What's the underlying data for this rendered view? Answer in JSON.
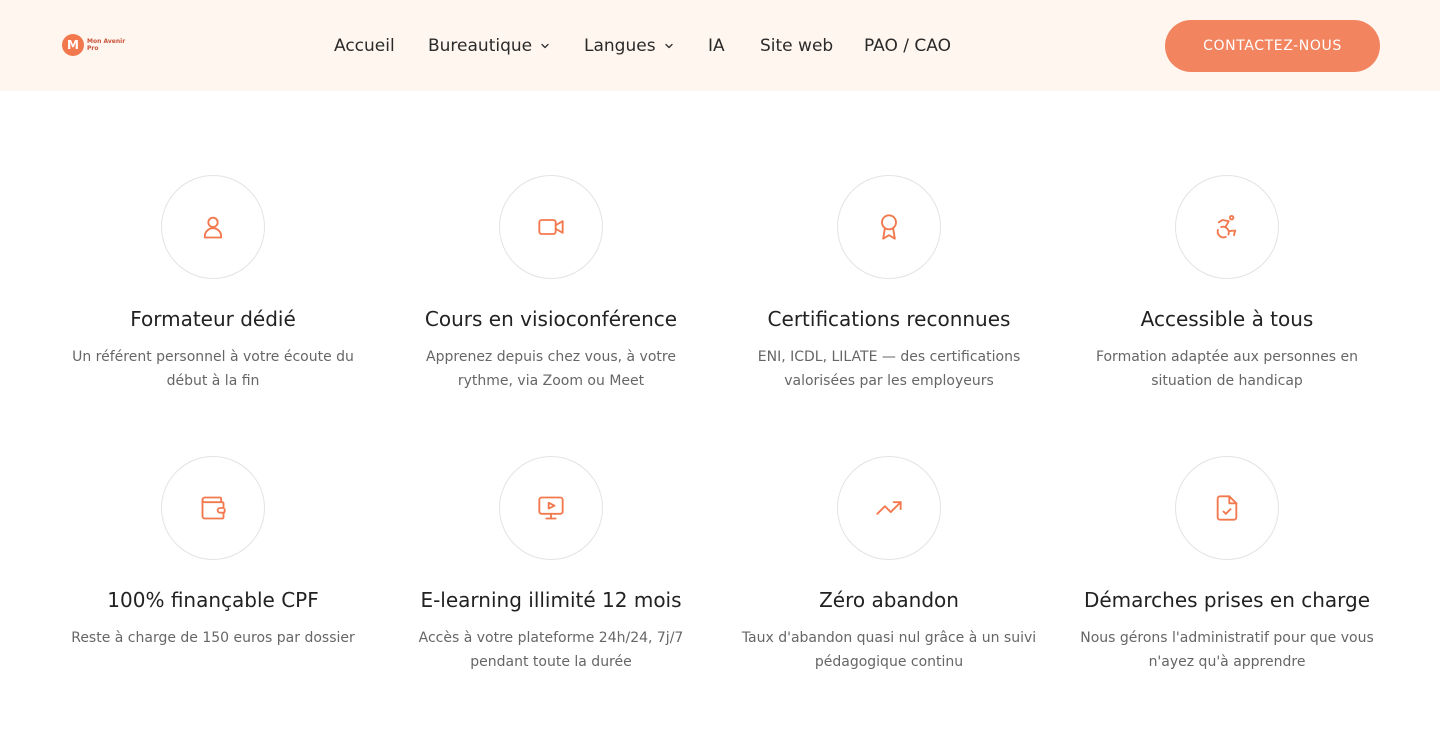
{
  "header": {
    "logo": {
      "mark": "M",
      "line1": "Mon Avenir",
      "line2": "Pro"
    },
    "nav": [
      {
        "label": "Accueil"
      },
      {
        "label": "Bureautique"
      },
      {
        "label": "Langues"
      },
      {
        "label": "IA"
      },
      {
        "label": "Site web"
      },
      {
        "label": "PAO / CAO"
      }
    ],
    "cta_label": "CONTACTEZ-NOUS"
  },
  "colors": {
    "accent": "#f2855f",
    "header_bg": "#fff6ef",
    "icon": "#f2794e"
  },
  "features": [
    {
      "icon": "user-icon",
      "title": "Formateur dédié",
      "desc": "Un référent personnel à votre écoute du début à la fin"
    },
    {
      "icon": "video-camera-icon",
      "title": "Cours en visioconférence",
      "desc": "Apprenez depuis chez vous, à votre rythme, via Zoom ou Meet"
    },
    {
      "icon": "award-icon",
      "title": "Certifications reconnues",
      "desc": "ENI, ICDL, LILATE — des certifications valorisées par les employeurs"
    },
    {
      "icon": "accessibility-icon",
      "title": "Accessible à tous",
      "desc": "Formation adaptée aux personnes en situation de handicap"
    },
    {
      "icon": "wallet-icon",
      "title": "100% finançable CPF",
      "desc": "Reste à charge de 150 euros par dossier"
    },
    {
      "icon": "monitor-play-icon",
      "title": "E-learning illimité 12 mois",
      "desc": "Accès à votre plateforme 24h/24, 7j/7 pendant toute la durée"
    },
    {
      "icon": "trending-up-icon",
      "title": "Zéro abandon",
      "desc": "Taux d'abandon quasi nul grâce à un suivi pédagogique continu"
    },
    {
      "icon": "file-check-icon",
      "title": "Démarches prises en charge",
      "desc": "Nous gérons l'administratif pour que vous n'ayez qu'à apprendre"
    }
  ]
}
